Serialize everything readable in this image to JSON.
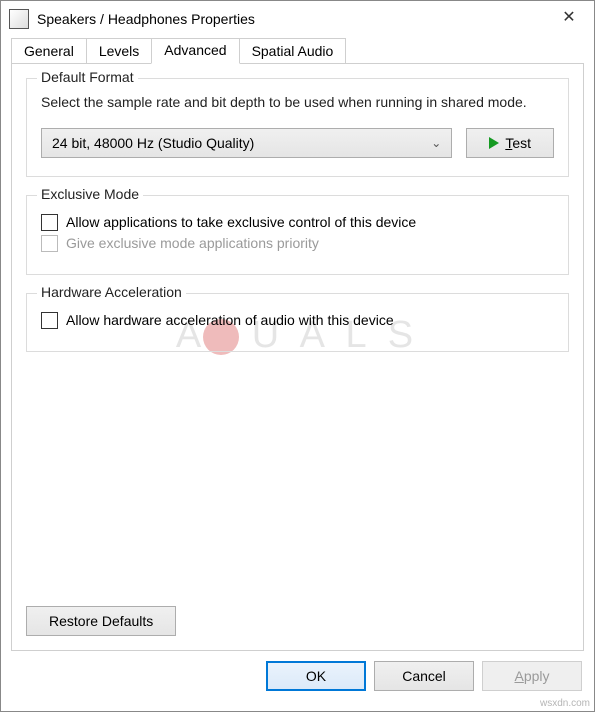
{
  "window": {
    "title": "Speakers / Headphones Properties"
  },
  "tabs": [
    "General",
    "Levels",
    "Advanced",
    "Spatial Audio"
  ],
  "activeTab": 2,
  "defaultFormat": {
    "legend": "Default Format",
    "desc": "Select the sample rate and bit depth to be used when running in shared mode.",
    "selected": "24 bit, 48000 Hz (Studio Quality)",
    "testLabel": "Test"
  },
  "exclusive": {
    "legend": "Exclusive Mode",
    "opt1": "Allow applications to take exclusive control of this device",
    "opt2": "Give exclusive mode applications priority"
  },
  "hw": {
    "legend": "Hardware Acceleration",
    "opt1": "Allow hardware acceleration of audio with this device"
  },
  "restore": "Restore Defaults",
  "footer": {
    "ok": "OK",
    "cancel": "Cancel",
    "apply": "Apply"
  },
  "corner": "wsxdn.com"
}
